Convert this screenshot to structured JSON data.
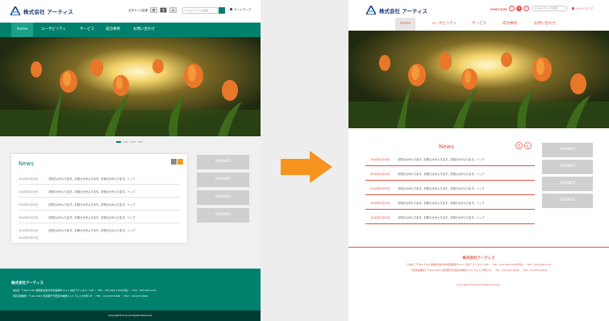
{
  "before": {
    "logo_text": "株式会社 アーティス",
    "fontsize_label": "文字サイズ変更",
    "fontsize_buttons": [
      "標",
      "準",
      "大"
    ],
    "search_placeholder": "Google サイト内検索",
    "sitemap_label": "サイトマップ",
    "nav": [
      "Home",
      "ユーザビリティ",
      "サービス",
      "成功事例",
      "お問い合わせ"
    ],
    "news_title": "News",
    "news": [
      {
        "date": "2016年2月29日",
        "text": "お知らせが入ります。お知らせが入ります。お知らせが入ります。トップ"
      },
      {
        "date": "2016年2月29日",
        "text": "お知らせが入ります。お知らせが入ります。お知らせが入ります。トップ"
      },
      {
        "date": "2016年2月29日",
        "text": "お知らせが入ります。お知らせが入ります。お知らせが入ります。トップ"
      },
      {
        "date": "2016年2月29日",
        "text": "お知らせが入ります。お知らせが入ります。お知らせが入ります。トップ"
      },
      {
        "date": "2016年2月29日",
        "text": "お知らせが入ります。お知らせが入ります。お知らせが入ります。トップ"
      },
      {
        "date": "2016年2月29日",
        "text": "お知らせが入ります。お知らせが入ります。お知らせが入ります。トップ"
      }
    ],
    "banners": [
      "BANNER",
      "BANNER",
      "BANNER",
      "BANNER"
    ],
    "footer_company": "株式会社アーティス",
    "footer_address_1": "【本社】〒430-7720 静岡県浜松市中区板屋町111-2 浜松アクトタワー20F ｜ TEL：053-459-1700(代表) ｜ FAX：053-459-1701",
    "footer_address_2": "【東京営業所】〒101-0047 東京都千代田区内神田2-4-3 アムス大手町 4F ｜ TEL：03-5207-8490 ｜ FAX：03-5207-8491",
    "copyright": "Copyright©Artis All Rights Reserved."
  },
  "after": {
    "logo_text": "株式会社 アーティス",
    "fontsize_label": "FONT SIZE",
    "fontsize_buttons": [
      "小",
      "中",
      "大"
    ],
    "search_placeholder": "Google サイト内検索",
    "sitemap_label": "サイトマップ",
    "nav": [
      "Home",
      "ユーザビリティ",
      "サービス",
      "成功事例",
      "お問い合わせ"
    ],
    "news_title": "News",
    "news": [
      {
        "date": "2016年2月29日",
        "text": "お知らせが入ります。お知らせが入ります。お知らせが入ります。トップ"
      },
      {
        "date": "2016年2月29日",
        "text": "お知らせが入ります。お知らせが入ります。お知らせが入ります。トップ"
      },
      {
        "date": "2016年2月29日",
        "text": "お知らせが入ります。お知らせが入ります。お知らせが入ります。トップ"
      },
      {
        "date": "2016年2月29日",
        "text": "お知らせが入ります。お知らせが入ります。お知らせが入ります。トップ"
      },
      {
        "date": "2016年2月29日",
        "text": "お知らせが入ります。お知らせが入ります。お知らせが入ります。トップ"
      }
    ],
    "banners": [
      "BANNER",
      "BANNER",
      "BANNER",
      "BANNER"
    ],
    "footer_company": "株式会社アーティス",
    "footer_address_1": "【本社】〒430-7720 静岡県浜松市中区板屋町111-2 浜松アクトタワー20F ｜ TEL：053-459-1700(代表) ｜ FAX：053-459-1701",
    "footer_address_2": "【東京営業所】〒101-0047 東京都千代田区内神田2-4-3 アムス大手町 4F ｜ TEL：03-5207-8490 ｜ FAX：03-5207-8491",
    "copyright": "Copyright©Artis All Rights Reserved."
  },
  "colors": {
    "before_accent": "#00806d",
    "after_accent": "#e05244",
    "arrow": "#f7941d"
  }
}
